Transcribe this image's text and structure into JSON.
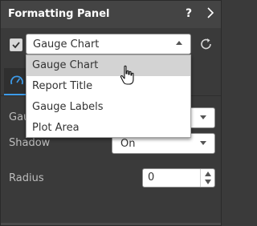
{
  "header": {
    "title": "Formatting Panel",
    "help_label": "?"
  },
  "target_select": {
    "value": "Gauge Chart"
  },
  "dropdown": {
    "options": [
      "Gauge Chart",
      "Report Title",
      "Gauge Labels",
      "Plot Area"
    ],
    "highlighted_index": 0
  },
  "rows": {
    "gauge_label_partial": "Gau",
    "shadow_label": "Shadow",
    "shadow_value": "On",
    "radius_label": "Radius",
    "radius_value": "0"
  },
  "colors": {
    "panel_bg": "#3a3a3a",
    "title_bg": "#444444",
    "accent": "#3d9be9",
    "highlight_bg": "#d3d3d3"
  },
  "icons": [
    "help-icon",
    "chevron-right-icon",
    "checkbox-check-icon",
    "chevron-down-icon",
    "reset-icon",
    "gauge-icon",
    "spinner-up-icon",
    "spinner-down-icon",
    "hand-cursor-icon"
  ]
}
